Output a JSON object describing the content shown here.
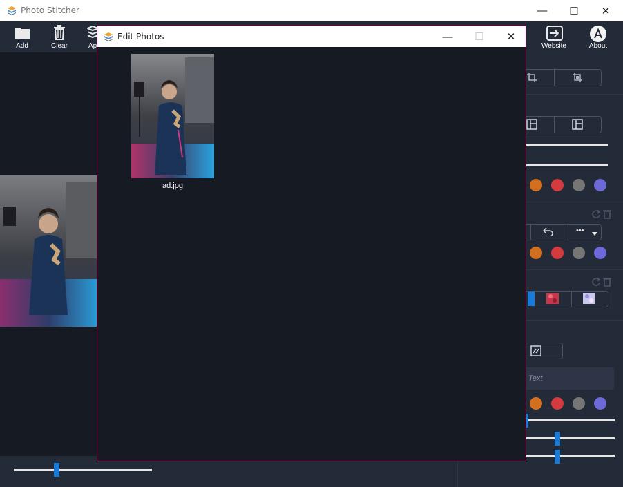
{
  "app": {
    "title": "Photo Stitcher"
  },
  "window_controls": {
    "minimize": "—",
    "maximize": "☐",
    "close": "✕"
  },
  "toolbar": {
    "add_label": "Add",
    "clear_label": "Clear",
    "ap_label": "Ap",
    "website_label": "Website",
    "about_label": "About"
  },
  "dialog": {
    "title": "Edit Photos",
    "minimize": "—",
    "maximize": "☐",
    "close": "✕",
    "photo": {
      "filename": "ad.jpg"
    }
  },
  "right_panel": {
    "text_placeholder": "Text",
    "more_label": "•••",
    "colors": [
      "#d3701f",
      "#d53a3f",
      "#767676",
      "#6e69d8"
    ]
  },
  "zoom": {
    "level": 0.33
  }
}
